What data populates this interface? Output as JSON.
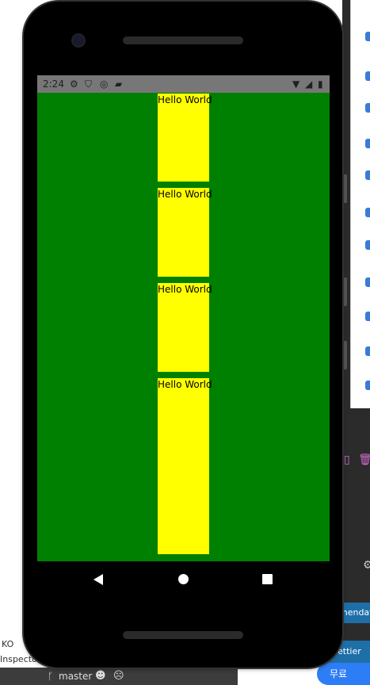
{
  "device": {
    "status_bar": {
      "time": "2:24",
      "icons": [
        "settings-icon",
        "shield-icon",
        "sync-icon",
        "sd-card-icon",
        "wifi-icon",
        "signal-icon",
        "battery-icon"
      ]
    },
    "boxes": [
      {
        "label": "Hello World"
      },
      {
        "label": "Hello World"
      },
      {
        "label": "Hello World"
      },
      {
        "label": "Hello World"
      }
    ],
    "nav": {
      "icons": [
        "back-icon",
        "home-icon",
        "recents-icon"
      ]
    }
  },
  "colors": {
    "screen_background": "#008000",
    "box_background": "#ffff00",
    "status_bar": "#777777"
  },
  "ide": {
    "left_text_1": "KO",
    "left_text_2": "Inspecto",
    "branch": "master",
    "recommend_label": "mendat",
    "prettier_label": "ettier",
    "free_label": "무료"
  }
}
